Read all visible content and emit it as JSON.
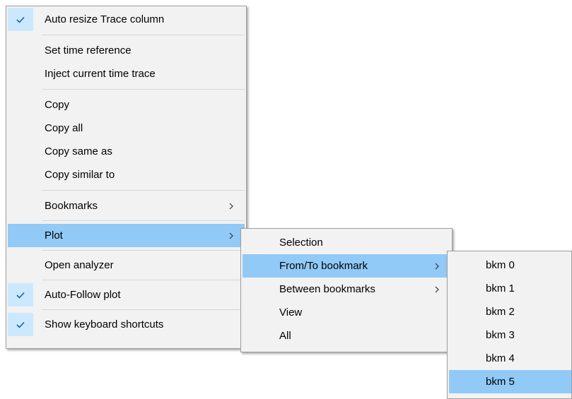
{
  "main_menu": {
    "items": [
      {
        "label": "Auto resize Trace column",
        "checked": true
      },
      {
        "label": "Set time reference"
      },
      {
        "label": "Inject current time trace"
      },
      {
        "label": "Copy"
      },
      {
        "label": "Copy all"
      },
      {
        "label": "Copy same as"
      },
      {
        "label": "Copy similar to"
      },
      {
        "label": "Bookmarks",
        "submenu": true
      },
      {
        "label": "Plot",
        "submenu": true,
        "highlighted": true
      },
      {
        "label": "Open analyzer"
      },
      {
        "label": "Auto-Follow plot",
        "checked": true
      },
      {
        "label": "Show keyboard shortcuts",
        "checked": true
      }
    ]
  },
  "plot_submenu": {
    "items": [
      {
        "label": "Selection"
      },
      {
        "label": "From/To bookmark",
        "submenu": true,
        "highlighted": true
      },
      {
        "label": "Between bookmarks",
        "submenu": true
      },
      {
        "label": "View"
      },
      {
        "label": "All"
      }
    ]
  },
  "bookmark_submenu": {
    "items": [
      {
        "label": "bkm 0"
      },
      {
        "label": "bkm 1"
      },
      {
        "label": "bkm 2"
      },
      {
        "label": "bkm 3"
      },
      {
        "label": "bkm 4"
      },
      {
        "label": "bkm 5",
        "highlighted": true
      }
    ]
  },
  "icons": {
    "check": "checkmark-icon",
    "submenu_arrow": "chevron-right-icon"
  },
  "colors": {
    "menu_bg": "#f2f2f2",
    "highlight": "#91c9f7",
    "check_bg": "#cce8ff",
    "check_mark": "#1a5fb4",
    "separator": "#d7d7d7"
  }
}
